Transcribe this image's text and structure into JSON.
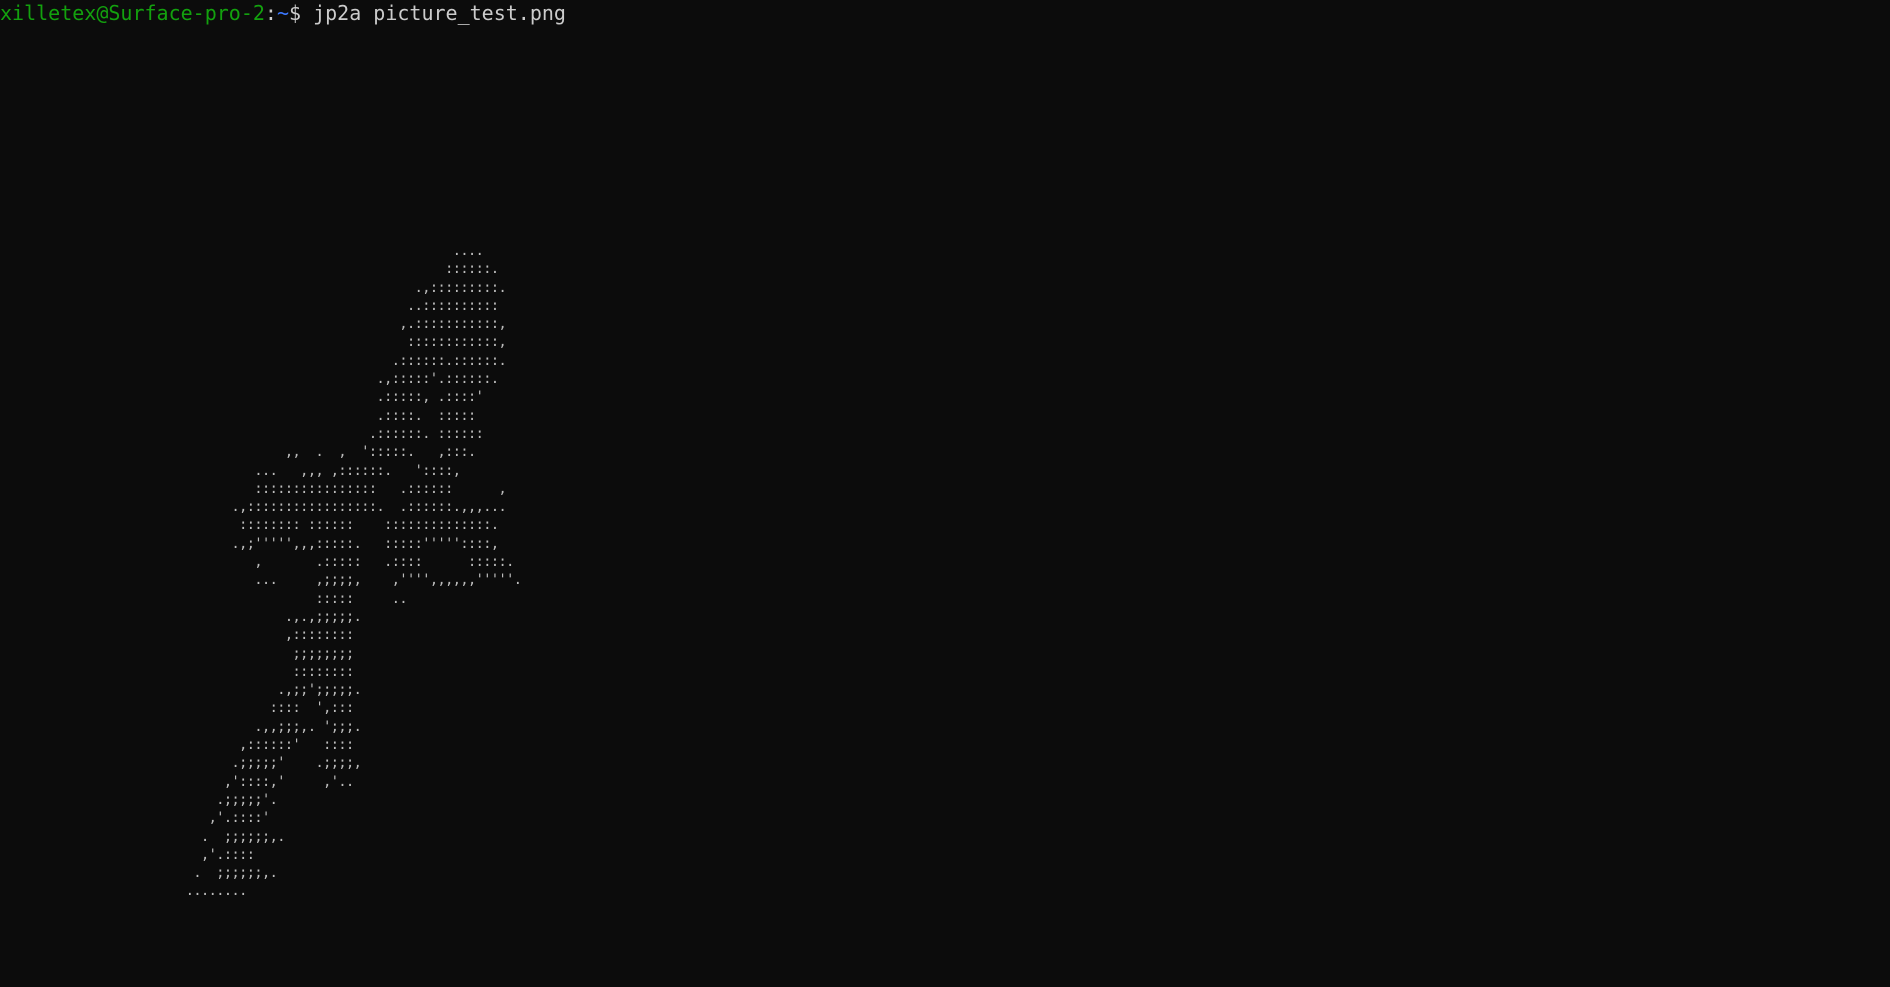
{
  "terminal": {
    "prompt": {
      "user_host": "xilletex@Surface-pro-2",
      "separator": ":",
      "cwd": "~",
      "symbol": "$ ",
      "command": "jp2a picture_test.png"
    },
    "output_lines": [
      "                                    ....",
      "                                   ::::::.",
      "                               .,:::::::::.",
      "                              ..::::::::::",
      "                             ,.:::::::::::,",
      "                              ::::::::::::,",
      "                            .::::::.::::::.",
      "                          .,:::::'.::::::.",
      "                          .:::::, .::::'",
      "                          .::::.  :::::",
      "                         .::::::. ::::::",
      "              ,,  .  ,  ':::::.   ,:::.",
      "          ...   ,,, ,::::::.   '::::,",
      "          ::::::::::::::::   .::::::      ,",
      "       .,:::::::::::::::::.  .::::::.,,,...",
      "        :::::::: ::::::    ::::::::::::::.",
      "       .,;''''',,,:::::.   :::::'''''::::,",
      "          ,       .:::::   .::::      :::::.",
      "          ...     ,;;;;,    ,'''',,,,,,'''''.",
      "                  :::::     ..",
      "              .,.,;;;;;.",
      "              ,::::::::",
      "               ;;;;;;;;",
      "               ::::::::",
      "             .,;;';;;;;.",
      "            ::::  ',:::",
      "          .,,;;;,. ';;;.",
      "        ,::::::'   ::::",
      "       .;;;;;'    .;;;;,",
      "      ,'::::,'     ,'..",
      "     .;;;;;'.",
      "    ,'.::::'",
      "   .  ;;;;;;,.",
      "   ,'.::::",
      "  .  ;;;;;;,.",
      " ........"
    ]
  }
}
